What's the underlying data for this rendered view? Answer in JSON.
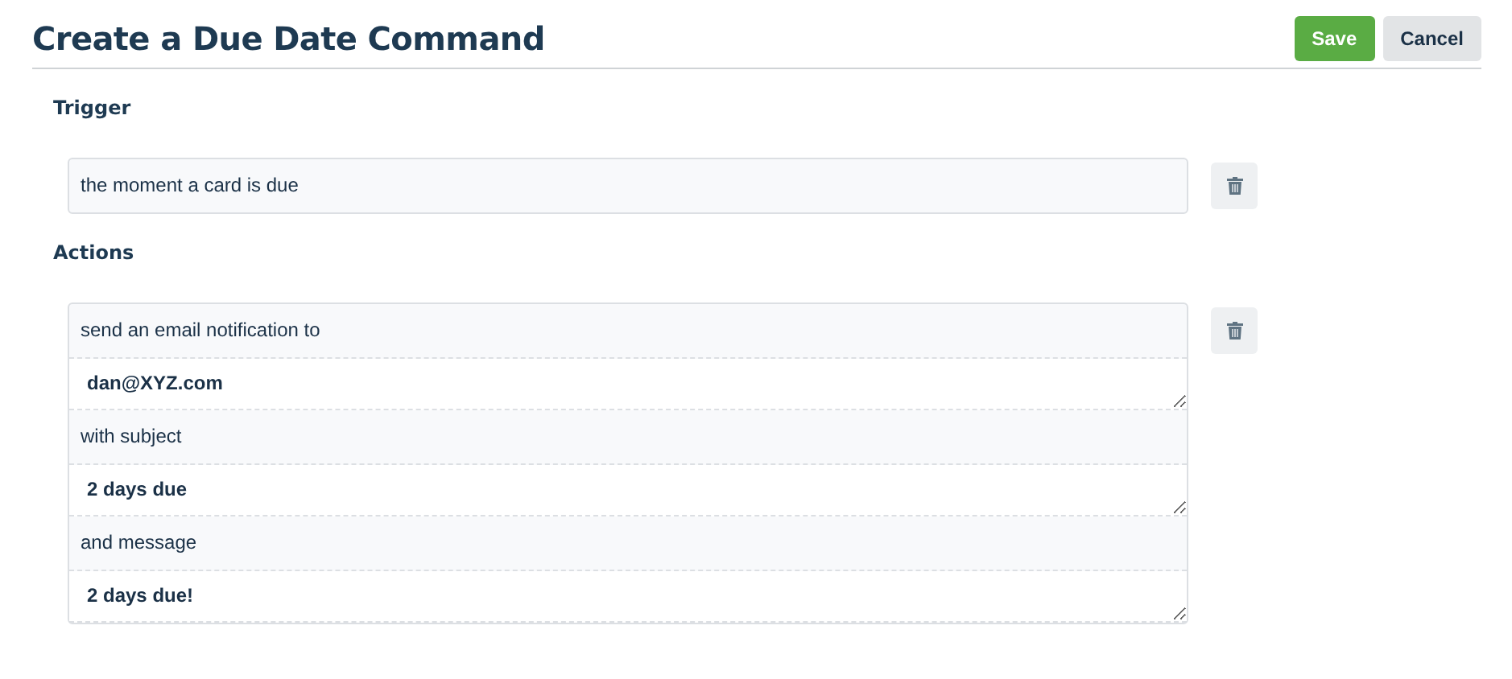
{
  "header": {
    "title": "Create a Due Date Command",
    "buttons": [
      {
        "label": "Save",
        "kind": "primary"
      },
      {
        "label": "Cancel",
        "kind": "secondary"
      }
    ]
  },
  "trigger": {
    "heading": "Trigger",
    "parts": [
      {
        "kind": "text",
        "text": "the moment a card is due"
      }
    ]
  },
  "actions": {
    "heading": "Actions",
    "parts": [
      {
        "kind": "text",
        "text": "send an email notification to"
      },
      {
        "kind": "input",
        "value": "dan@XYZ.com"
      },
      {
        "kind": "text",
        "text": "with subject"
      },
      {
        "kind": "input",
        "value": "2 days due"
      },
      {
        "kind": "text",
        "text": "and message"
      },
      {
        "kind": "input",
        "value": "2 days due!"
      }
    ]
  }
}
